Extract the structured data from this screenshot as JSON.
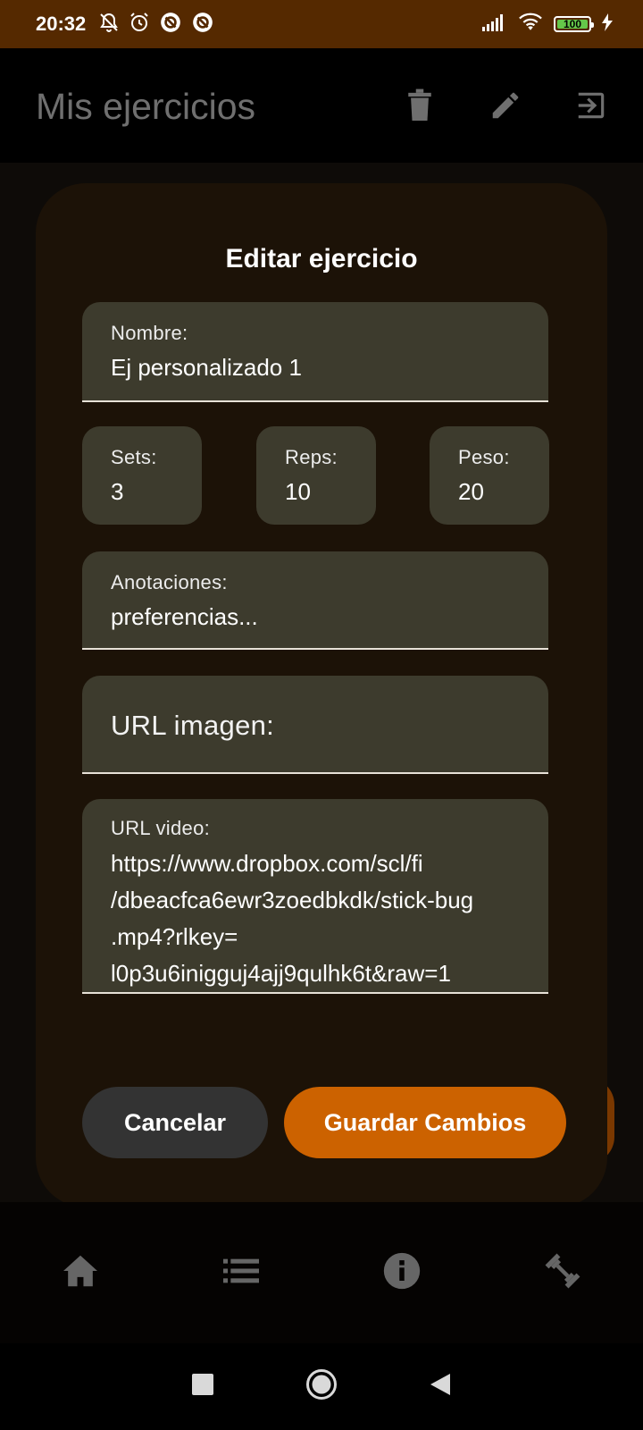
{
  "status_bar": {
    "time": "20:32",
    "battery": "100"
  },
  "app_bar": {
    "title": "Mis ejercicios"
  },
  "dialog": {
    "title": "Editar ejercicio",
    "nombre": {
      "label": "Nombre:",
      "value": "Ej personalizado 1"
    },
    "sets": {
      "label": "Sets:",
      "value": "3"
    },
    "reps": {
      "label": "Reps:",
      "value": "10"
    },
    "peso": {
      "label": "Peso:",
      "value": "20"
    },
    "anotaciones": {
      "label": "Anotaciones:",
      "value": "preferencias..."
    },
    "url_imagen": {
      "label": "URL imagen:",
      "value": ""
    },
    "url_video": {
      "label": "URL video:",
      "lines": [
        "https://www.dropbox.com/scl/fi",
        "/dbeacfca6ewr3zoedbkdk/stick-bug",
        ".mp4?rlkey=",
        "l0p3u6inigguj4ajj9qulhk6t&raw=1"
      ]
    },
    "cancel_label": "Cancelar",
    "save_label": "Guardar Cambios"
  },
  "icons": {
    "app_bar": [
      "delete-icon",
      "edit-icon",
      "logout-icon"
    ],
    "bottom_nav": [
      "home-icon",
      "list-icon",
      "info-icon",
      "fitness-icon"
    ],
    "system_nav": [
      "recents-icon",
      "home-circle-icon",
      "back-icon"
    ]
  },
  "colors": {
    "status_bar": "#552900",
    "dialog": "#1c1207",
    "field": "#3d3b2d",
    "primary": "#cc6200",
    "secondary_button": "#333333"
  }
}
